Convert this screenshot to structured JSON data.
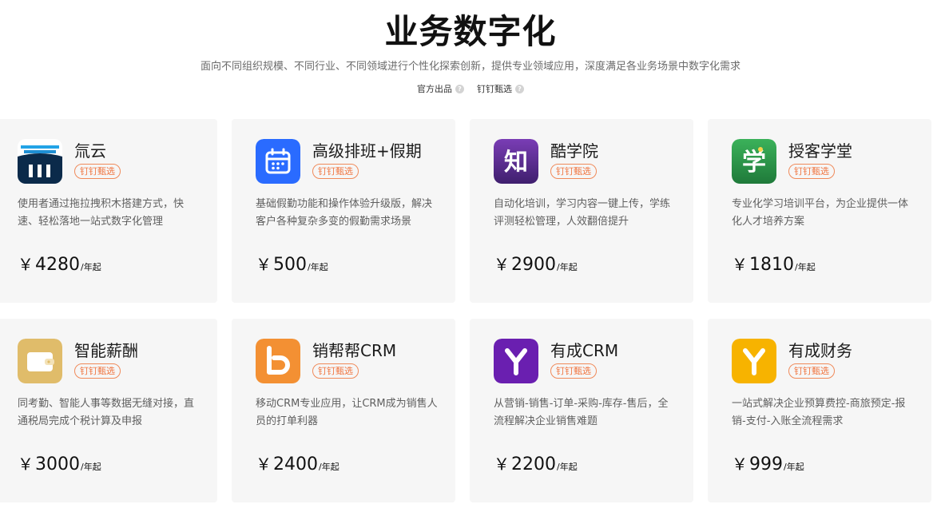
{
  "header": {
    "title": "业务数字化",
    "subtitle": "面向不同组织规模、不同行业、不同领域进行个性化探索创新，提供专业领域应用，深度满足各业务场景中数字化需求",
    "filters": [
      {
        "label": "官方出品",
        "icon": "question-icon"
      },
      {
        "label": "钉钉甄选",
        "icon": "question-icon"
      }
    ]
  },
  "products": [
    {
      "name": "氚云",
      "badge": "钉钉甄选",
      "desc": "使用者通过拖拉拽积木搭建方式，快速、轻松落地一站式数字化管理",
      "currency": "￥",
      "price": "4280",
      "unit": "/年起",
      "icon": "chuanyun-logo-icon",
      "color": "#0b2a4a"
    },
    {
      "name": "高级排班+假期",
      "badge": "钉钉甄选",
      "desc": "基础假勤功能和操作体验升级版，解决客户各种复杂多变的假勤需求场景",
      "currency": "￥",
      "price": "500",
      "unit": "/年起",
      "icon": "calendar-icon",
      "color": "#2a6bff"
    },
    {
      "name": "酷学院",
      "badge": "钉钉甄选",
      "desc": "自动化培训，学习内容一键上传，学练评测轻松管理，人效翻倍提升",
      "currency": "￥",
      "price": "2900",
      "unit": "/年起",
      "icon": "zhi-char-icon",
      "color": "#5c2e8f"
    },
    {
      "name": "授客学堂",
      "badge": "钉钉甄选",
      "desc": "专业化学习培训平台，为企业提供一体化人才培养方案",
      "currency": "￥",
      "price": "1810",
      "unit": "/年起",
      "icon": "xue-char-icon",
      "color": "#2e9a4b"
    },
    {
      "name": "智能薪酬",
      "badge": "钉钉甄选",
      "desc": "同考勤、智能人事等数据无缝对接，直通税局完成个税计算及申报",
      "currency": "￥",
      "price": "3000",
      "unit": "/年起",
      "icon": "wallet-icon",
      "color": "#e0bc6a"
    },
    {
      "name": "销帮帮CRM",
      "badge": "钉钉甄选",
      "desc": "移动CRM专业应用，让CRM成为销售人员的打单利器",
      "currency": "￥",
      "price": "2400",
      "unit": "/年起",
      "icon": "letter-b-icon",
      "color": "#f39033"
    },
    {
      "name": "有成CRM",
      "badge": "钉钉甄选",
      "desc": "从营销-销售-订单-采购-库存-售后，全流程解决企业销售难题",
      "currency": "￥",
      "price": "2200",
      "unit": "/年起",
      "icon": "y-logo-icon",
      "color": "#6a1fb0"
    },
    {
      "name": "有成财务",
      "badge": "钉钉甄选",
      "desc": "一站式解决企业预算费控-商旅预定-报销-支付-入账全流程需求",
      "currency": "￥",
      "price": "999",
      "unit": "/年起",
      "icon": "y-logo-icon",
      "color": "#f7b300"
    }
  ]
}
